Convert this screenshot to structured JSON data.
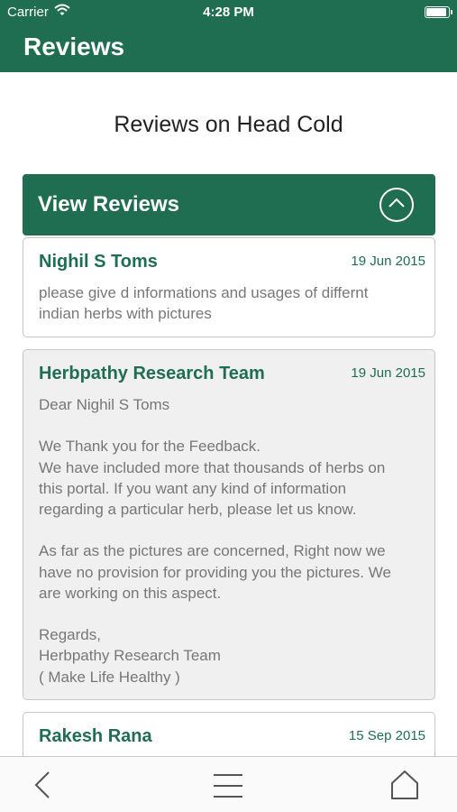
{
  "status_bar": {
    "carrier": "Carrier",
    "time": "4:28 PM",
    "battery_level": 0.95
  },
  "nav": {
    "title": "Reviews"
  },
  "page": {
    "heading": "Reviews on Head Cold"
  },
  "accordion": {
    "label": "View Reviews",
    "toggle_icon": "chevron-up-circle-icon"
  },
  "reviews": [
    {
      "name": "Nighil S Toms",
      "date": "19 Jun 2015",
      "lines": [
        "please give d informations and usages of differnt",
        "indian herbs with pictures"
      ]
    },
    {
      "name": "Herbpathy Research Team",
      "date": "19 Jun 2015",
      "lines": [
        "Dear Nighil S Toms",
        "",
        "We Thank you for the Feedback.",
        "We have included more that thousands of herbs on",
        "this portal.  If you want any kind of information",
        "regarding a particular herb, please let us know.",
        "",
        "As far as the pictures are concerned,  Right now we",
        "have no provision for providing you the pictures.  We",
        "are working on this aspect.",
        "",
        "Regards,",
        "Herbpathy Research Team",
        "( Make Life Healthy )"
      ]
    },
    {
      "name": "Rakesh Rana",
      "date": "15 Sep 2015",
      "lines": []
    }
  ],
  "tab_bar": {
    "icons": [
      "back-chevron-icon",
      "menu-icon",
      "home-icon"
    ]
  },
  "colors": {
    "brand_green": "#1f6e52",
    "reply_background": "#f0f0f0",
    "body_text": "#777777"
  }
}
